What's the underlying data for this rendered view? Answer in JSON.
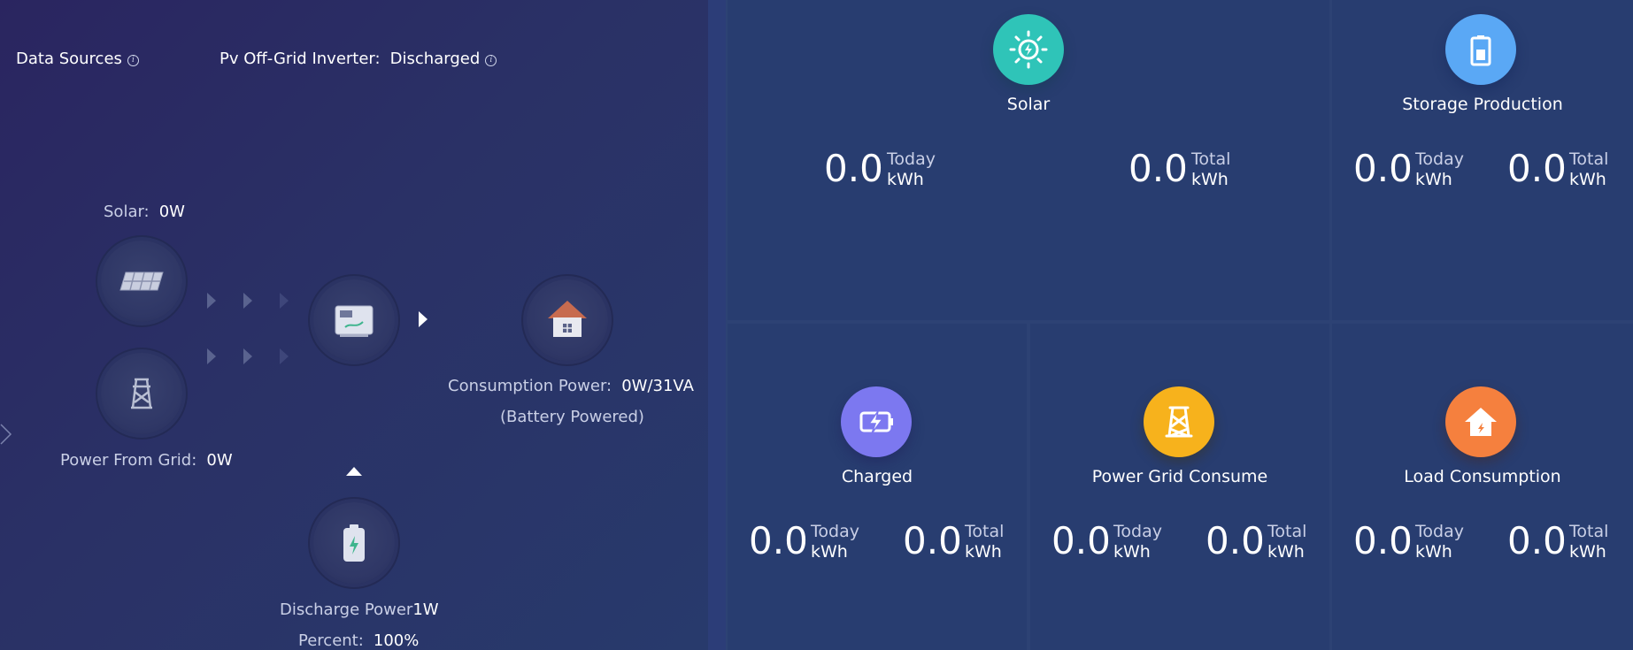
{
  "left": {
    "data_sources_label": "Data Sources",
    "inverter_label": "Pv Off-Grid Inverter:",
    "inverter_status": "Discharged",
    "solar_label": "Solar:",
    "solar_value": "0W",
    "grid_label": "Power From Grid:",
    "grid_value": "0W",
    "consumption_label": "Consumption Power:",
    "consumption_value": "0W/31VA",
    "consumption_note": "(Battery Powered)",
    "discharge_label": "Discharge Power",
    "discharge_value": "1W",
    "percent_label": "Percent:",
    "percent_value": "100%"
  },
  "panels": {
    "solar": {
      "title": "Solar",
      "today_value": "0.0",
      "today_label": "Today",
      "today_unit": "kWh",
      "total_value": "0.0",
      "total_label": "Total",
      "total_unit": "kWh",
      "color": "#2fc4b8",
      "icon": "sun-icon"
    },
    "storage": {
      "title": "Storage Production",
      "today_value": "0.0",
      "today_label": "Today",
      "today_unit": "kWh",
      "total_value": "0.0",
      "total_label": "Total",
      "total_unit": "kWh",
      "color": "#5aa8f5",
      "icon": "battery-icon"
    },
    "charged": {
      "title": "Charged",
      "today_value": "0.0",
      "today_label": "Today",
      "today_unit": "kWh",
      "total_value": "0.0",
      "total_label": "Total",
      "total_unit": "kWh",
      "color": "#7c78f0",
      "icon": "battery-charge-icon"
    },
    "grid": {
      "title": "Power Grid Consume",
      "today_value": "0.0",
      "today_label": "Today",
      "today_unit": "kWh",
      "total_value": "0.0",
      "total_label": "Total",
      "total_unit": "kWh",
      "color": "#f7b21c",
      "icon": "power-tower-icon"
    },
    "load": {
      "title": "Load Consumption",
      "today_value": "0.0",
      "today_label": "Today",
      "today_unit": "kWh",
      "total_value": "0.0",
      "total_label": "Total",
      "total_unit": "kWh",
      "color": "#f5803e",
      "icon": "house-icon"
    }
  }
}
